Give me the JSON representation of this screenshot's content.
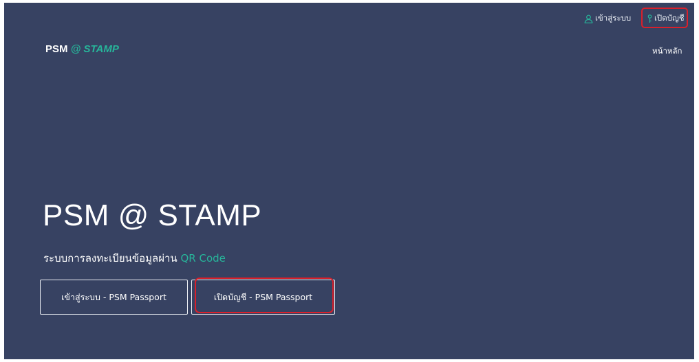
{
  "top_links": {
    "login": {
      "label": "เข้าสู่ระบบ",
      "icon": "user-icon",
      "icon_color": "#27b59a"
    },
    "register": {
      "label": "เปิดบัญชี",
      "icon": "key-icon",
      "icon_color": "#27b59a"
    }
  },
  "navbar": {
    "brand_prefix": "PSM",
    "brand_accent": "@ STAMP",
    "home_link": "หน้าหลัก"
  },
  "hero": {
    "title": "PSM @ STAMP",
    "subtitle_text": "ระบบการลงทะเบียนข้อมูลผ่าน",
    "subtitle_accent": "QR Code",
    "login_button": "เข้าสู่ระบบ - PSM Passport",
    "register_button": "เปิดบัญชี - PSM Passport"
  },
  "colors": {
    "background": "#374262",
    "accent": "#27b59a",
    "highlight": "#d9202b"
  }
}
